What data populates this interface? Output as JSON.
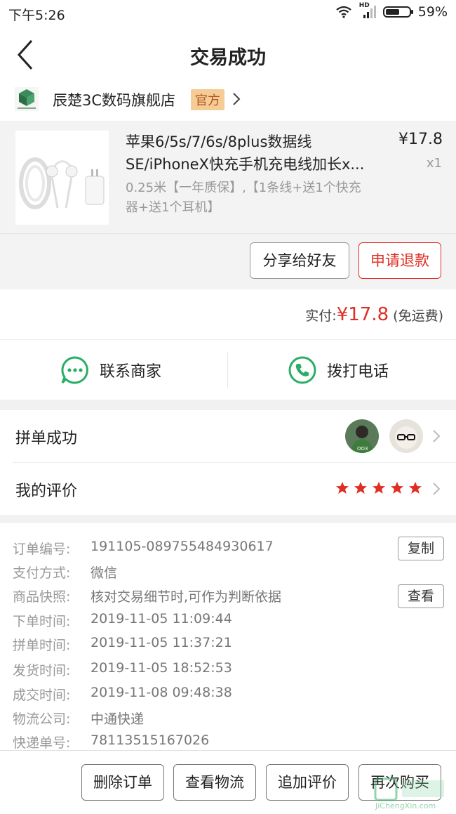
{
  "status_bar": {
    "time": "下午5:26",
    "network": "HD",
    "battery": "59%",
    "battery_level": 0.59
  },
  "nav": {
    "title": "交易成功"
  },
  "shop": {
    "name": "辰楚3C数码旗舰店",
    "badge": "官方"
  },
  "product": {
    "title_line1": "苹果6/5s/7/6s/8plus数据线",
    "title_line2": "SE/iPhoneX快充手机充电线加长x...",
    "spec_line1": "0.25米【一年质保】,【1条线+送1个快充",
    "spec_line2": "器+送1个耳机】",
    "price": "¥17.8",
    "quantity": "x1"
  },
  "actions": {
    "share": "分享给好友",
    "refund": "申请退款"
  },
  "payment": {
    "label": "实付:",
    "currency": "¥",
    "amount": "17.8",
    "shipping": "(免运费)"
  },
  "contact": {
    "merchant": "联系商家",
    "call": "拨打电话"
  },
  "group": {
    "label": "拼单成功"
  },
  "review": {
    "label": "我的评价",
    "stars": 5
  },
  "details": [
    {
      "label": "订单编号:",
      "value": "191105-089755484930617"
    },
    {
      "label": "支付方式:",
      "value": "微信"
    },
    {
      "label": "商品快照:",
      "value": "核对交易细节时,可作为判断依据"
    },
    {
      "label": "下单时间:",
      "value": "2019-11-05 11:09:44"
    },
    {
      "label": "拼单时间:",
      "value": "2019-11-05 11:37:21"
    },
    {
      "label": "发货时间:",
      "value": "2019-11-05 18:52:53"
    },
    {
      "label": "成交时间:",
      "value": "2019-11-08 09:48:38"
    },
    {
      "label": "物流公司:",
      "value": "中通快递"
    },
    {
      "label": "快递单号:",
      "value": "78113515167026"
    }
  ],
  "detail_buttons": {
    "copy": "复制",
    "view": "查看"
  },
  "bottom_bar": {
    "delete": "删除订单",
    "logistics": "查看物流",
    "add_review": "追加评价",
    "buy_again": "再次购买"
  },
  "watermark": {
    "text": "JiChengXin.com"
  },
  "colors": {
    "accent": "#e02e24",
    "wechat_green": "#2aae67",
    "badge_bg": "#f5cc96"
  }
}
